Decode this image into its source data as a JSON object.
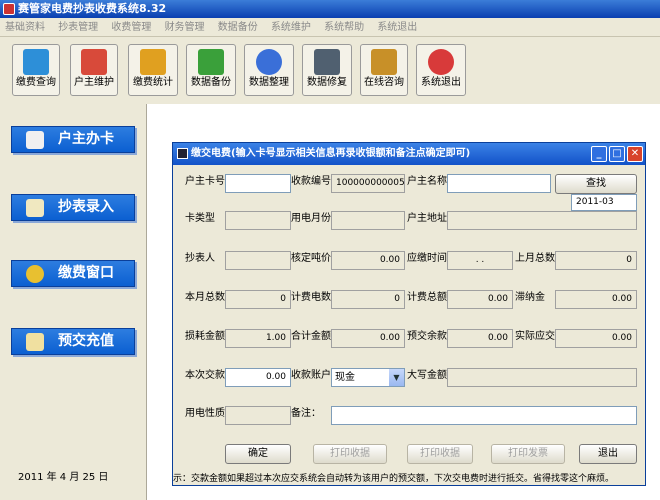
{
  "app": {
    "title": "赛管家电费抄表收费系统8.32"
  },
  "menu": [
    "基础资料",
    "抄表管理",
    "收费管理",
    "财务管理",
    "数据备份",
    "系统维护",
    "系统帮助",
    "系统退出"
  ],
  "toolbar": [
    {
      "label": "缴费查询",
      "icon": "search-icon",
      "color": "#2d8fd8"
    },
    {
      "label": "户主维护",
      "icon": "users-icon",
      "color": "#d84a3a"
    },
    {
      "label": "缴费统计",
      "icon": "box-icon",
      "color": "#e0a020"
    },
    {
      "label": "数据备份",
      "icon": "backup-icon",
      "color": "#3aa03a"
    },
    {
      "label": "数据整理",
      "icon": "pie-chart-icon",
      "color": "#3a6fd8"
    },
    {
      "label": "数据修复",
      "icon": "laptop-icon",
      "color": "#506070"
    },
    {
      "label": "在线咨询",
      "icon": "notepad-icon",
      "color": "#c89028"
    },
    {
      "label": "系统退出",
      "icon": "power-icon",
      "color": "#d83a3a"
    }
  ],
  "sidebar": [
    {
      "label": "户主办卡",
      "icon": "user-card-icon"
    },
    {
      "label": "抄表录入",
      "icon": "pen-icon"
    },
    {
      "label": "缴费窗口",
      "icon": "coins-icon"
    },
    {
      "label": "预交充值",
      "icon": "pencil-icon"
    }
  ],
  "date": "2011 年   4 月 25 日",
  "dialog": {
    "title": "缴交电费(输入卡号显示相关信息再录收银额和备注点确定即可)",
    "labels": {
      "card_no": "户主卡号",
      "receipt_no": "收款编号",
      "owner_name": "户主名称",
      "card_type": "卡类型",
      "month": "用电月份",
      "owner_addr": "户主地址",
      "reader": "抄表人",
      "unit_price": "核定吨价",
      "due_time": "应缴时间",
      "last_total": "上月总数",
      "this_total": "本月总数",
      "meter_qty": "计费电数",
      "meter_total": "计费总额",
      "late_fee": "滞纳金",
      "loss_amount": "损耗金额",
      "sum_amount": "合计金额",
      "prepay_bal": "预交余款",
      "actual_due": "实际应交",
      "this_paid": "本次交款",
      "account": "收款账户",
      "upper_amount": "大写金额",
      "power_type": "用电性质",
      "remark": "备注："
    },
    "values": {
      "receipt_no": "100000000005",
      "date_sel": "2011-03",
      "unit_price": "0.00",
      "due_time": ". .",
      "last_total": "0",
      "this_total": "0",
      "meter_qty": "0",
      "meter_total": "0.00",
      "late_fee": "0.00",
      "loss_amount": "1.00",
      "sum_amount": "0.00",
      "prepay_bal": "0.00",
      "actual_due": "0.00",
      "this_paid": "0.00",
      "account": "现金"
    },
    "buttons": {
      "find": "查找",
      "ok": "确定",
      "print_receipt": "打印收据",
      "print_invoice": "打印收据",
      "print_bill": "打印发票",
      "exit": "退出"
    },
    "hint": "示：交款金额如果超过本次应交系统会自动转为该用户的预交额，下次交电费时进行抵交。省得找零这个麻烦。"
  }
}
